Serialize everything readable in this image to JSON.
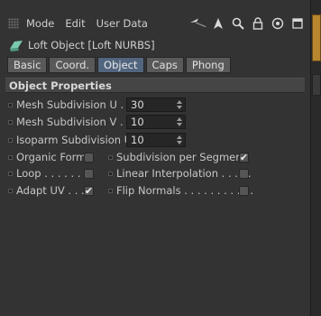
{
  "menubar": {
    "items": [
      "Mode",
      "Edit",
      "User Data"
    ],
    "tools": [
      "back-arrow-icon",
      "up-arrow-icon",
      "search-icon",
      "lock-icon",
      "target-icon",
      "new-window-icon"
    ]
  },
  "object": {
    "title": "Loft Object [Loft NURBS]",
    "icon": "loft-object-icon",
    "accent": "#79c9b0"
  },
  "tabs": [
    {
      "label": "Basic",
      "active": false
    },
    {
      "label": "Coord.",
      "active": false
    },
    {
      "label": "Object",
      "active": true
    },
    {
      "label": "Caps",
      "active": false
    },
    {
      "label": "Phong",
      "active": false
    }
  ],
  "section_title": "Object Properties",
  "fields": [
    {
      "label": "Mesh Subdivision U . . .",
      "value": "30"
    },
    {
      "label": "Mesh Subdivision V . . .",
      "value": "10"
    },
    {
      "label": "Isoparm Subdivision U",
      "value": "10"
    }
  ],
  "checkboxes_left": [
    {
      "label": "Organic Form",
      "checked": false
    },
    {
      "label": "Loop . . . . . . . .",
      "checked": false
    },
    {
      "label": "Adapt UV . . .",
      "checked": true
    }
  ],
  "checkboxes_right": [
    {
      "label": "Subdivision per Segment",
      "checked": true
    },
    {
      "label": "Linear Interpolation . . . . .",
      "checked": false
    },
    {
      "label": "Flip Normals . . . . . . . . . . .",
      "checked": false
    }
  ],
  "check_mark": "✔"
}
